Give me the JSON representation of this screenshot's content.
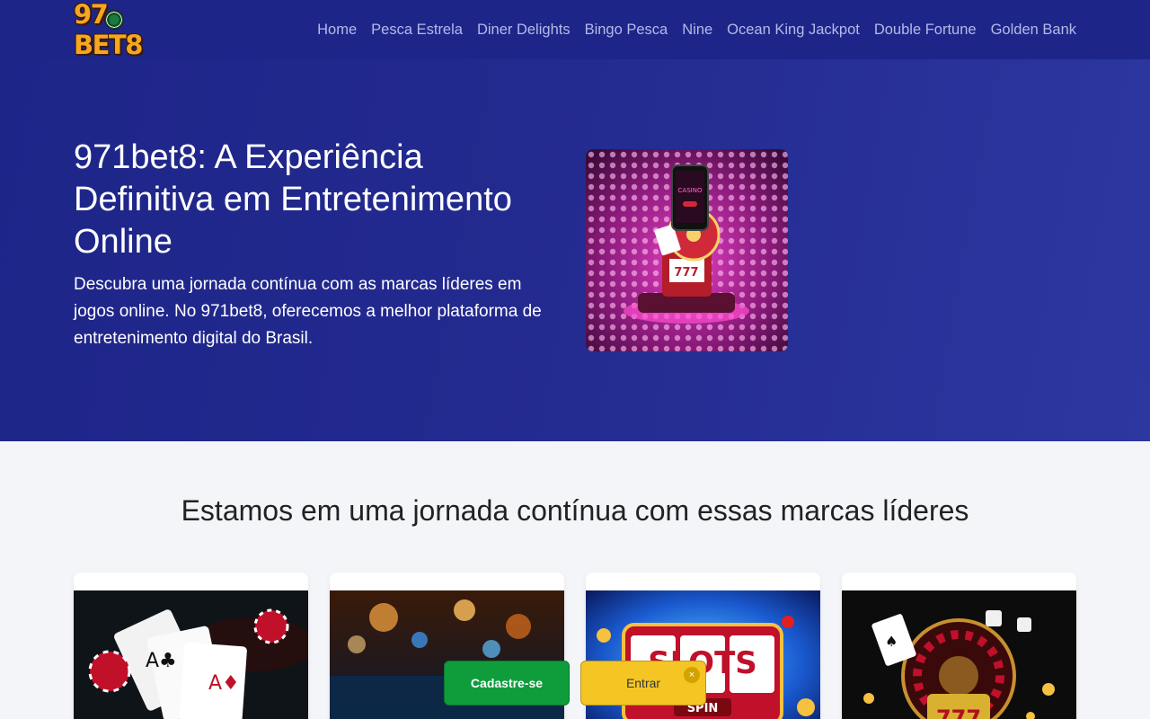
{
  "logo": {
    "text": "971BET8",
    "text_before": "97",
    "text_after": "BET8"
  },
  "nav": {
    "links": [
      "Home",
      "Pesca Estrela",
      "Diner Delights",
      "Bingo Pesca",
      "Nine",
      "Ocean King Jackpot",
      "Double Fortune",
      "Golden Bank"
    ]
  },
  "hero": {
    "title": "971bet8: A Experiência Definitiva em Entretenimento Online",
    "description": "Descubra uma jornada contínua com as marcas líderes em jogos online. No 971bet8, oferecemos a melhor plataforma de entretenimento digital do Brasil.",
    "image_icon": "casino-slot-machine-illustration"
  },
  "partners": {
    "title": "Estamos em uma jornada contínua com essas marcas líderes",
    "cards": [
      {
        "image": "playing-cards-and-chips"
      },
      {
        "image": "casino-blurred-lights"
      },
      {
        "image": "slots-machine"
      },
      {
        "image": "roulette-and-777"
      }
    ]
  },
  "cta": {
    "register_label": "Cadastre-se",
    "login_label": "Entrar",
    "close_symbol": "×"
  },
  "colors": {
    "nav_bg": "#1e2589",
    "hero_bg": "#232a8f",
    "register_bg": "#0f9d3c",
    "login_bg": "#f5c623"
  }
}
